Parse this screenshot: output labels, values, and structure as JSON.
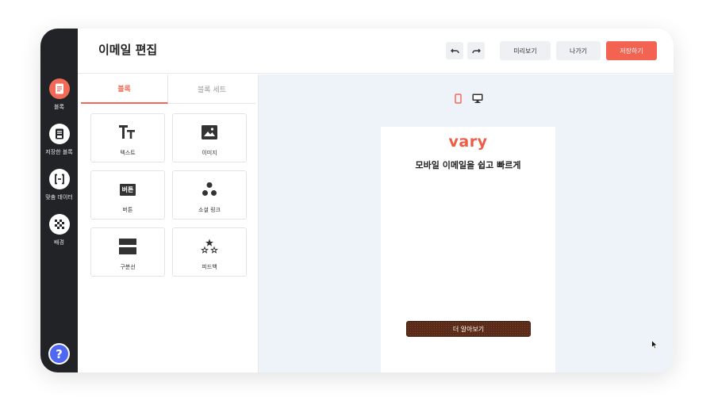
{
  "header": {
    "title": "이메일 편집",
    "undo_icon": "undo-icon",
    "redo_icon": "redo-icon",
    "preview_label": "미리보기",
    "exit_label": "나가기",
    "save_label": "저장하기"
  },
  "sidebar": {
    "items": [
      {
        "label": "블록",
        "icon": "document-icon"
      },
      {
        "label": "저장한 블록",
        "icon": "saved-block-icon"
      },
      {
        "label": "맞춤 데이터",
        "icon": "custom-data-icon"
      },
      {
        "label": "배경",
        "icon": "checker-icon"
      }
    ],
    "help": "?"
  },
  "panel": {
    "tabs": [
      {
        "label": "블록",
        "active": true
      },
      {
        "label": "블록 세트",
        "active": false
      }
    ],
    "blocks": [
      {
        "label": "텍스트",
        "icon": "text-icon"
      },
      {
        "label": "이미지",
        "icon": "image-icon"
      },
      {
        "label": "버튼",
        "icon": "button-icon",
        "badge": "버튼"
      },
      {
        "label": "소셜 링크",
        "icon": "social-icon"
      },
      {
        "label": "구분선",
        "icon": "divider-icon"
      },
      {
        "label": "피드백",
        "icon": "stars-icon"
      }
    ]
  },
  "canvas": {
    "devices": [
      "mobile-icon",
      "desktop-icon"
    ],
    "active_device": "mobile",
    "email": {
      "logo": "vary",
      "headline": "모바일 이메일을 쉽고 빠르게",
      "cta_label": "더 알아보기"
    }
  },
  "colors": {
    "accent": "#f06a57",
    "rail": "#222326",
    "help": "#4f67f2",
    "canvas": "#eef3fa",
    "cta": "#5a2a18"
  }
}
